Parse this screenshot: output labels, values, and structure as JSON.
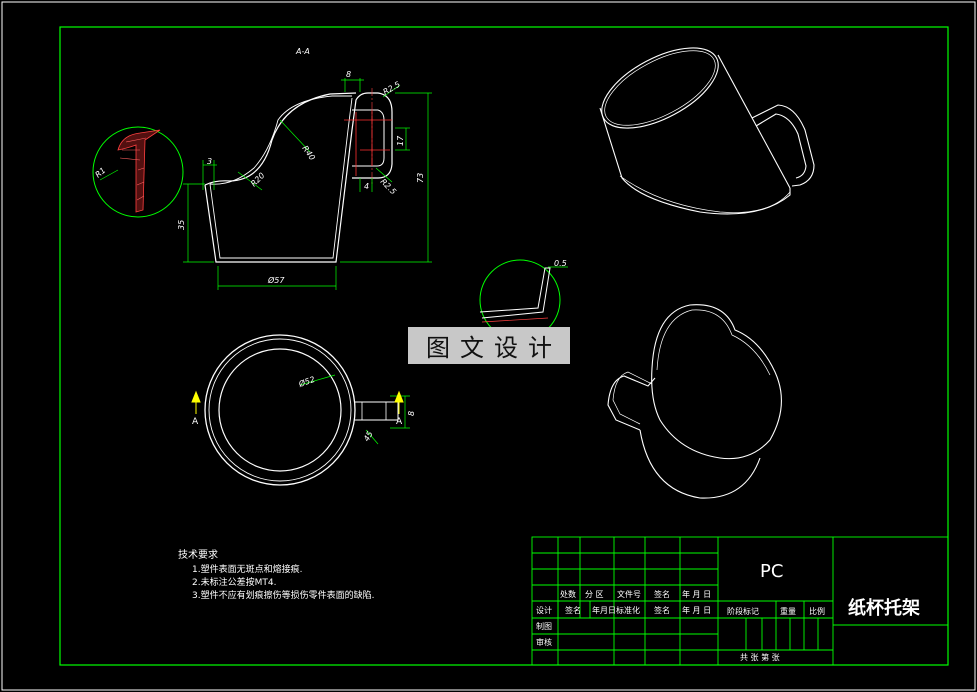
{
  "section_label": "A-A",
  "dimensions": {
    "d1": "8",
    "d2": "R2.5",
    "d3": "R40",
    "d4": "R20",
    "d5": "3",
    "d6": "73",
    "d7": "17",
    "d8": "35",
    "d9": "Ø57",
    "d10": "4",
    "d11": "R2.5",
    "d12": "R1",
    "d13": "0.5",
    "d14": "Ø52",
    "d15": "8",
    "d16": "45"
  },
  "section_marks": {
    "left": "A",
    "right": "A"
  },
  "watermark": "图文设计",
  "technical_requirements": {
    "title": "技术要求",
    "items": [
      "1.塑件表面无斑点和熔接痕.",
      "2.未标注公差按MT4.",
      "3.塑件不应有划痕擦伤等损伤零件表面的缺陷."
    ]
  },
  "title_block": {
    "material": "PC",
    "part_name": "纸杯托架",
    "row_labels": [
      "处数",
      "分 区",
      "文件号",
      "签名",
      "年 月 日"
    ],
    "design_row": [
      "设计",
      "签名",
      "年月日",
      "标准化",
      "签名",
      "年 月 日"
    ],
    "drawing": "制图",
    "review": "审核",
    "stage_mark": "阶段标记",
    "weight": "重量",
    "scale": "比例",
    "sheets": "共   张 第   张"
  }
}
